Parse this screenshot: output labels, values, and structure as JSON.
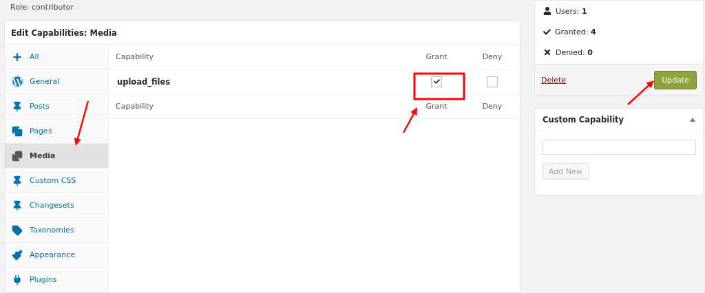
{
  "role_label": "Role: contributor",
  "editor": {
    "title": "Edit Capabilities: Media",
    "sidebar": [
      {
        "label": "All",
        "selected": false
      },
      {
        "label": "General",
        "selected": false
      },
      {
        "label": "Posts",
        "selected": false
      },
      {
        "label": "Pages",
        "selected": false
      },
      {
        "label": "Media",
        "selected": true
      },
      {
        "label": "Custom CSS",
        "selected": false
      },
      {
        "label": "Changesets",
        "selected": false
      },
      {
        "label": "Taxonomies",
        "selected": false
      },
      {
        "label": "Appearance",
        "selected": false
      },
      {
        "label": "Plugins",
        "selected": false
      }
    ],
    "table": {
      "header": [
        "Capability",
        "Grant",
        "Deny"
      ],
      "rows": [
        {
          "capability": "upload_files",
          "grant": true,
          "deny": false
        }
      ],
      "footer": [
        "Capability",
        "Grant",
        "Deny"
      ]
    }
  },
  "summary": {
    "stats": [
      {
        "kind": "users",
        "label": "Users:",
        "value": "1"
      },
      {
        "kind": "granted",
        "label": "Granted:",
        "value": "4"
      },
      {
        "kind": "denied",
        "label": "Denied:",
        "value": "0"
      }
    ],
    "delete_link": "Delete",
    "update_button": "Update"
  },
  "custom_capability": {
    "title": "Custom Capability",
    "button": "Add New"
  }
}
